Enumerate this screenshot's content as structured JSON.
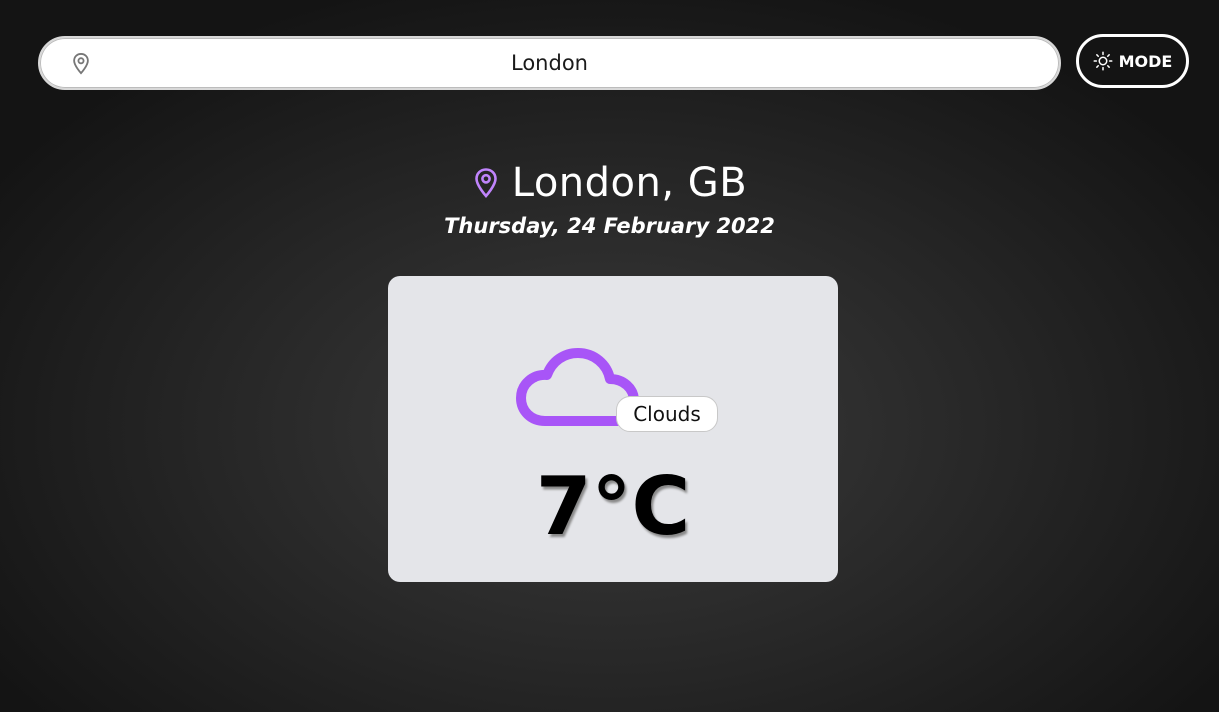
{
  "search": {
    "value": "London",
    "icon": "location-pin-icon"
  },
  "mode_button": {
    "label": "MODE",
    "icon": "sun-icon"
  },
  "location": {
    "title": "London, GB",
    "icon": "location-pin-icon",
    "date": "Thursday, 24 February 2022"
  },
  "weather": {
    "icon": "cloud-icon",
    "condition": "Clouds",
    "temperature": "7°C"
  },
  "colors": {
    "accent": "#a855f7",
    "pin_light": "#c084fc",
    "card_bg": "#e4e5e9"
  }
}
